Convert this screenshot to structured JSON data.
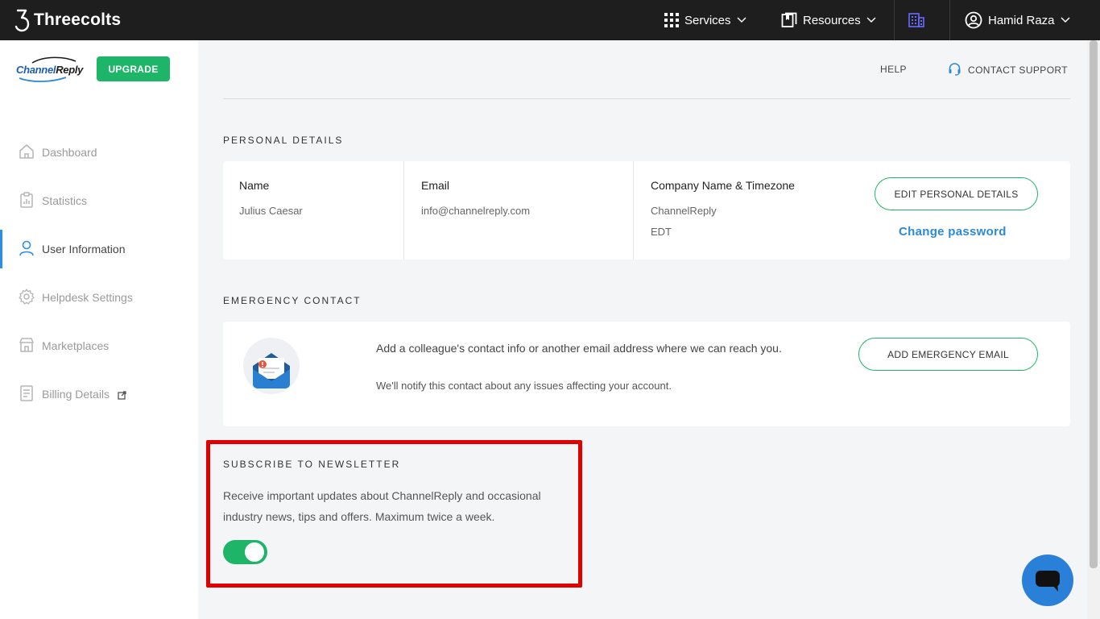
{
  "topbar": {
    "brand": "Threecolts",
    "services_label": "Services",
    "resources_label": "Resources",
    "user_name": "Hamid Raza"
  },
  "sidebar": {
    "logo_text_1": "Channel",
    "logo_text_2": "Reply",
    "upgrade_label": "UPGRADE",
    "items": [
      {
        "label": "Dashboard",
        "icon": "home-icon"
      },
      {
        "label": "Statistics",
        "icon": "clipboard-icon"
      },
      {
        "label": "User Information",
        "icon": "user-icon",
        "active": true
      },
      {
        "label": "Helpdesk Settings",
        "icon": "gear-icon"
      },
      {
        "label": "Marketplaces",
        "icon": "store-icon"
      },
      {
        "label": "Billing Details",
        "icon": "billing-icon"
      }
    ]
  },
  "header": {
    "help_label": "HELP",
    "support_label": "CONTACT SUPPORT"
  },
  "personal": {
    "title": "PERSONAL DETAILS",
    "name_label": "Name",
    "name_value": "Julius Caesar",
    "email_label": "Email",
    "email_value": "info@channelreply.com",
    "company_label": "Company Name & Timezone",
    "company_value": "ChannelReply",
    "timezone_value": "EDT",
    "edit_button": "EDIT PERSONAL DETAILS",
    "change_password": "Change password"
  },
  "emergency": {
    "title": "EMERGENCY CONTACT",
    "text1": "Add a colleague's contact info or another email address where we can reach you.",
    "text2": "We'll notify this contact about any issues affecting your account.",
    "button": "ADD EMERGENCY EMAIL"
  },
  "newsletter": {
    "title": "SUBSCRIBE TO NEWSLETTER",
    "description": "Receive important updates about ChannelReply and occasional industry news, tips and offers. Maximum twice a week.",
    "subscribed": true
  },
  "colors": {
    "accent_green": "#1fb568",
    "link_blue": "#2a8ad8",
    "highlight_red": "#e00000",
    "chat_blue": "#2a7fd8"
  }
}
